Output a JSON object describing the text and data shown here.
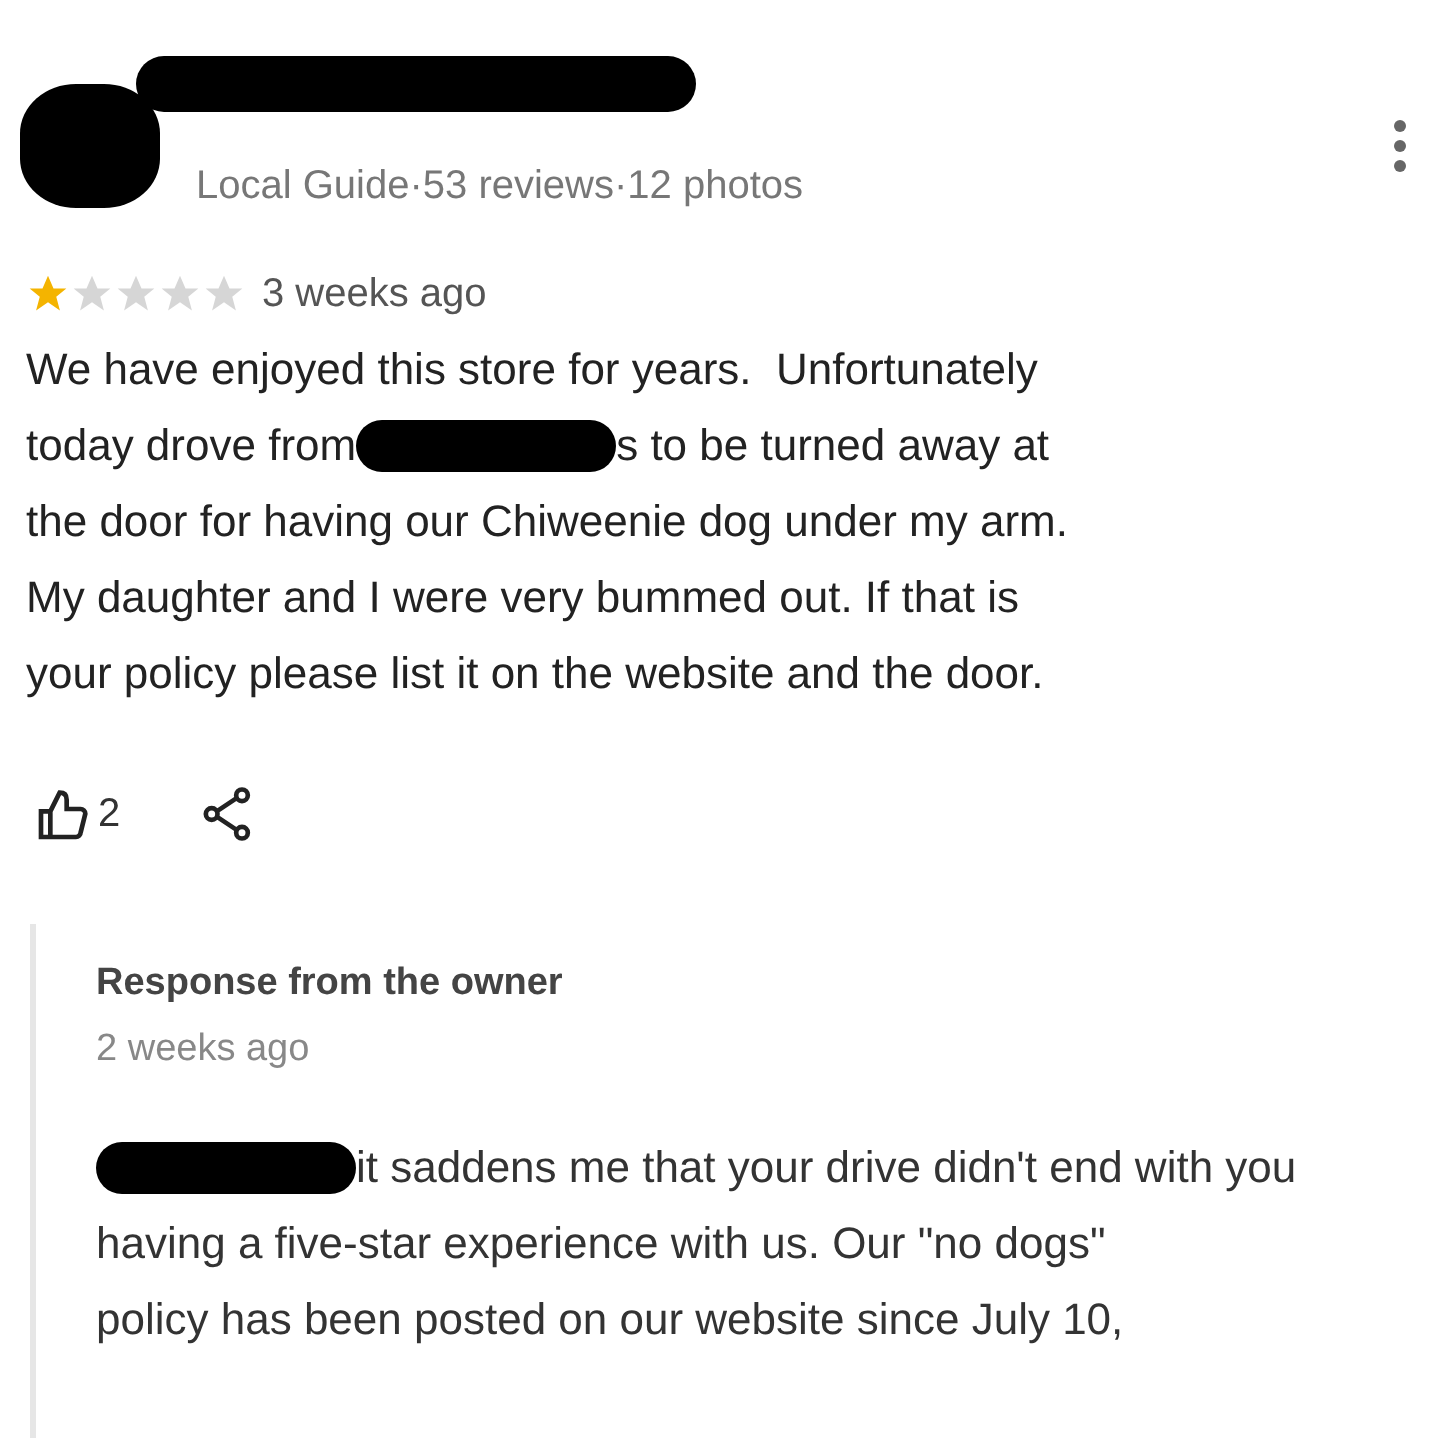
{
  "reviewer": {
    "meta": "Local Guide·53 reviews·12 photos"
  },
  "review": {
    "stars": 1,
    "time": "3 weeks ago",
    "lines": [
      [
        {
          "kind": "text",
          "text": "We have enjoyed this store for years.  Unfortunately"
        }
      ],
      [
        {
          "kind": "text",
          "text": "today drove from"
        },
        {
          "kind": "redaction"
        },
        {
          "kind": "text",
          "text": "s to be turned away at"
        }
      ],
      [
        {
          "kind": "text",
          "text": "the door for having our Chiweenie dog under my arm."
        }
      ],
      [
        {
          "kind": "text",
          "text": "My daughter and I were very bummed out. If that is"
        }
      ],
      [
        {
          "kind": "text",
          "text": "your policy please list it on the website and the door."
        }
      ]
    ],
    "likes": "2"
  },
  "response": {
    "title": "Response from the owner",
    "time": "2 weeks ago",
    "lines": [
      [
        {
          "kind": "redaction"
        },
        {
          "kind": "text",
          "text": "it saddens me that your drive didn't end with you"
        }
      ],
      [
        {
          "kind": "text",
          "text": "having a five-star experience with us. Our \"no dogs\""
        }
      ],
      [
        {
          "kind": "text",
          "text": "policy has been posted on our website since July 10,"
        }
      ]
    ]
  }
}
